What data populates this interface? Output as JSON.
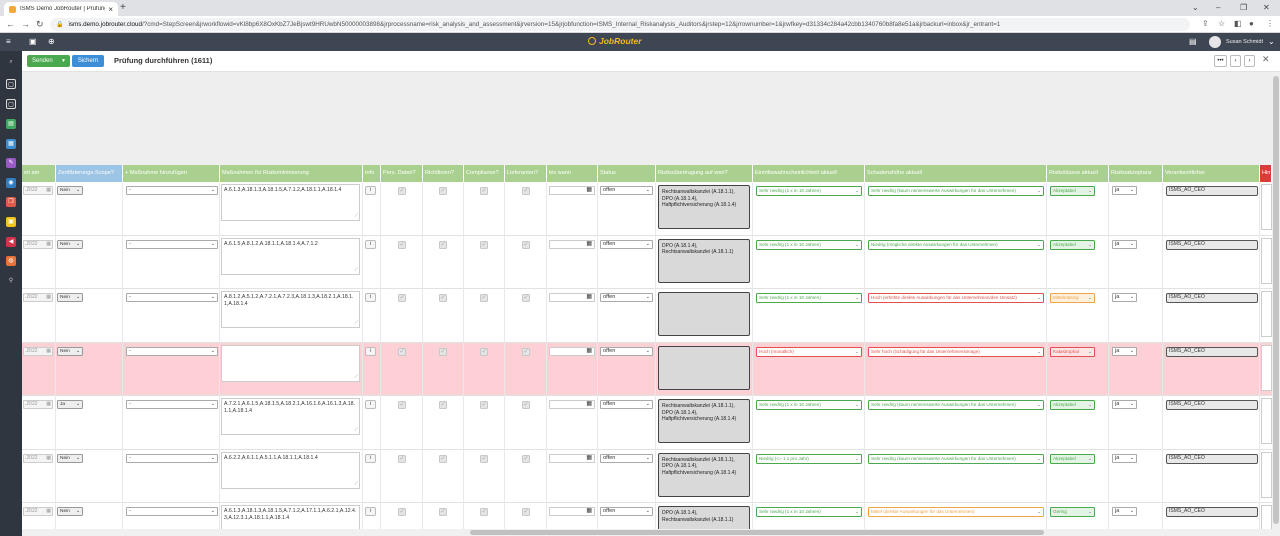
{
  "browser": {
    "tab_title": "ISMS Demo JobRouter | Prüfung",
    "tab_close": "×",
    "new_tab": "+",
    "url_host": "isms.demo.jobrouter.cloud",
    "url_rest": "/?cmd=StepScreen&jrworkflowid=vKl8bp6X8OxKbZ7JeBjswt9HRUwbN50000003898&jrprocessname=risk_analysis_and_assessment&jrversion=15&jrjobfunction=ISMS_Internal_Riskanalysis_Auditors&jrstep=12&jrrownumber=1&jrwfkey=d31334c284a42cbb1340760b8fa8e51a&jrbackurl=inbox&jr_entrant=1"
  },
  "app": {
    "logo_text": "JobRouter",
    "user_name": "Susan Schmidt"
  },
  "toolbar": {
    "send_label": "Senden",
    "save_label": "Sichern",
    "title": "Prüfung durchführen (1611)"
  },
  "headers": [
    "eit am",
    "Zertifizierungs-Scope?",
    "+ Maßnahme hinzufügen",
    "Maßnahmen für Risikominimierung",
    "Info",
    "Pers. Daten?",
    "Richtlinien?",
    "Compliance?",
    "Lieferanten?",
    "bis wann",
    "Status",
    "Risikoübertragung auf wen?",
    "Eintrittswahrscheinlichkeit aktuell",
    "Schadenshöhe aktuell",
    "Risikoklasse aktuell",
    "Risikoakzeptanz",
    "Verantwortlicher",
    "Hin"
  ],
  "rows": [
    {
      "date": ".2022",
      "scope": "Nein",
      "add": "-",
      "measures": "A.6.1.3,A.18.1.3,A.18.1.5,A.7.1.2,A.18.1.1,A.18.1.4",
      "info": "i",
      "status": "offen",
      "transfer": "Rechtsanwaltskanzlei (A.18.1.1), DPO (A.18.1.4), Haftpflichtversicherung (A.18.1.4)",
      "prob": "Sehr niedrig (1 x in 10 Jahren)",
      "damage": "Sehr niedrig (kaum nennenswerte Auswirkungen für das Unternehmen)",
      "class": "Akzeptabel",
      "accept": "ja",
      "resp": "ISMS_AO_CEO"
    },
    {
      "date": ".2022",
      "scope": "Nein",
      "add": "-",
      "measures": "A.6.1.5,A.8.1.2,A.18.1.1,A.18.1.4,A.7.1.2",
      "info": "i",
      "status": "offen",
      "transfer": "DPO (A.18.1.4), Rechtsanwaltskanzlei (A.18.1.1)",
      "prob": "Sehr niedrig (1 x in 10 Jahren)",
      "damage": "Niedrig (mögliche direkte Auswirkungen für das Unternehmen)",
      "class": "Akzeptabel",
      "accept": "ja",
      "resp": "ISMS_AO_CEO"
    },
    {
      "date": ".2022",
      "scope": "Nein",
      "add": "-",
      "measures": "A.8.1.2,A.5.1.2,A.7.2.1,A.7.2.3,A.18.1.3,A.18.2.1,A.18.1.1,A.18.1.4",
      "info": "i",
      "status": "offen",
      "transfer": "",
      "prob": "Sehr niedrig (1 x in 10 Jahren)",
      "damage": "Hoch (erhöhte direkte Auswirkungen für das Unternehmen/den Umsatz)",
      "class": "Mittelmässig",
      "accept": "ja",
      "resp": "ISMS_AO_CEO"
    },
    {
      "date": ".2022",
      "scope": "Nein",
      "add": "-",
      "measures": "",
      "info": "i",
      "status": "offen",
      "transfer": "",
      "prob": "Hoch (monatlich)",
      "damage": "Sehr hoch (Schädigung für das Unternehmensimage)",
      "class": "Katastrophal",
      "accept": "ja",
      "resp": "ISMS_AO_CEO"
    },
    {
      "date": ".2022",
      "scope": "Ja",
      "add": "-",
      "measures": "A.7.2.1,A.6.1.5,A.18.1.5,A.18.2.1,A.16.1.6,A.16.1.3,A.18.1.1,A.18.1.4",
      "info": "i",
      "status": "offen",
      "transfer": "Rechtsanwaltskanzlei (A.18.1.1), DPO (A.18.1.4), Haftpflichtversicherung (A.18.1.4)",
      "prob": "Sehr niedrig (1 x in 10 Jahren)",
      "damage": "Sehr niedrig (kaum nennenswerte Auswirkungen für das Unternehmen)",
      "class": "Akzeptabel",
      "accept": "ja",
      "resp": "ISMS_AO_CEO"
    },
    {
      "date": ".2022",
      "scope": "Nein",
      "add": "-",
      "measures": "A.6.2.2,A.6.1.1,A.5.1.1,A.18.1.1,A.18.1.4",
      "info": "i",
      "status": "offen",
      "transfer": "Rechtsanwaltskanzlei (A.18.1.1), DPO (A.18.1.4), Haftpflichtversicherung (A.18.1.4)",
      "prob": "Niedrig (<= 1 x pro Jahr)",
      "damage": "Sehr niedrig (kaum nennenswerte Auswirkungen für das Unternehmen)",
      "class": "Akzeptabel",
      "accept": "ja",
      "resp": "ISMS_AO_CEO"
    },
    {
      "date": ".2022",
      "scope": "Nein",
      "add": "-",
      "measures": "A.6.1.3,A.18.1.3,A.18.1.5,A.7.1.2,A.17.1.1,A.6.2.1,A.12.4.3,A.12.3.1,A.18.1.1,A.18.1.4",
      "info": "i",
      "status": "offen",
      "transfer": "DPO (A.18.1.4), Rechtsanwaltskanzlei (A.18.1.1)",
      "prob": "Sehr niedrig (1 x in 10 Jahren)",
      "damage": "Mittel (direkte Auswirkungen für das Unternehmen)",
      "class": "Gering",
      "accept": "ja",
      "resp": "ISMS_AO_CEO"
    }
  ]
}
